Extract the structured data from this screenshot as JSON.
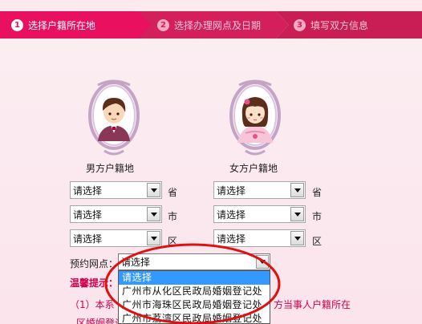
{
  "steps": [
    {
      "num": "1",
      "label": "选择户籍所在地",
      "active": true
    },
    {
      "num": "2",
      "label": "选择办理网点及日期",
      "active": false
    },
    {
      "num": "3",
      "label": "填写双方信息",
      "active": false
    }
  ],
  "male": {
    "title": "男方户籍地",
    "province": "请选择",
    "city": "请选择",
    "district": "请选择"
  },
  "female": {
    "title": "女方户籍地",
    "province": "请选择",
    "city": "请选择",
    "district": "请选择"
  },
  "units": {
    "province": "省",
    "city": "市",
    "district": "区"
  },
  "point": {
    "label": "预约网点：",
    "value": "请选择",
    "options": [
      "请选择",
      "广州市从化区民政局婚姻登记处",
      "广州市海珠区民政局婚姻登记处",
      "广州市荔湾区民政局婚姻登记处"
    ]
  },
  "tips": {
    "title": "温馨提示：",
    "line1_prefix": "（1）本系",
    "line1_suffix": "方当事人户籍所在",
    "line2": "区婚姻登记"
  },
  "colors": {
    "active_step": "#e8105f",
    "inactive_step": "#d31f5c",
    "tip_text": "#d2004d",
    "annotation": "#e01010"
  }
}
